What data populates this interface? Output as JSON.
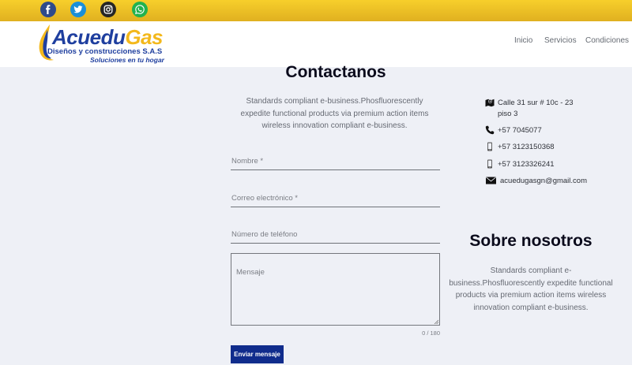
{
  "social": [
    {
      "icon": "facebook-icon",
      "color": "#3b5998"
    },
    {
      "icon": "twitter-icon",
      "color": "#1da1f2"
    },
    {
      "icon": "instagram-icon",
      "color": "#262626"
    },
    {
      "icon": "whatsapp-icon",
      "color": "#25d366"
    }
  ],
  "logo": {
    "name_part1": "Acuedu",
    "name_part2": "Gas",
    "subtitle": "Diseños y construcciones S.A.S",
    "tagline": "Soluciones en tu hogar"
  },
  "nav": [
    "Inicio",
    "Servicios",
    "Condiciones"
  ],
  "contact": {
    "title": "Contactanos",
    "description": "Standards compliant e-business.Phosfluorescently expedite functional products via premium action items wireless innovation compliant e-business."
  },
  "form": {
    "name_label": "Nombre *",
    "email_label": "Correo electrónico *",
    "phone_label": "Número de teléfono",
    "message_label": "Mensaje",
    "counter": "0 / 180",
    "submit_label": "Enviar mensaje"
  },
  "info": {
    "address_line1": "Calle 31 sur # 10c - 23",
    "address_line2": "piso 3",
    "phone": "+57 7045077",
    "mobile1": "+57 3123150368",
    "mobile2": "+57 3123326241",
    "email": "acuedugasgn@gmail.com"
  },
  "about": {
    "title": "Sobre nosotros",
    "description": "Standards compliant e-business.Phosfluorescently expedite functional products via premium action items wireless innovation compliant e-business."
  },
  "colors": {
    "topbar": "#f5c825",
    "brand_blue": "#1f3f9f",
    "brand_yellow": "#f3b81c",
    "button": "#102c8c",
    "background": "#eef0f6"
  }
}
